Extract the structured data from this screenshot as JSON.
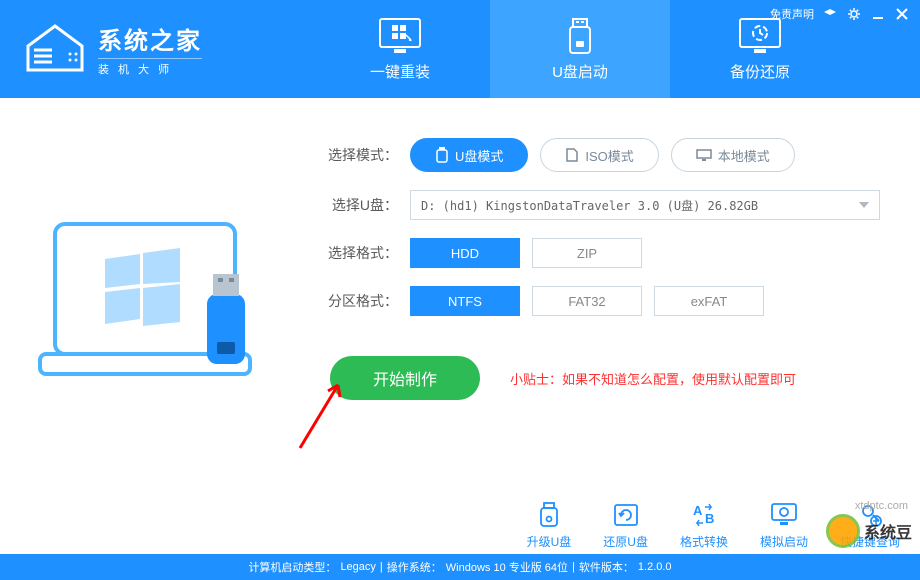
{
  "header": {
    "logo_title": "系统之家",
    "logo_sub": "装 机 大 师",
    "disclaimer": "免责声明"
  },
  "nav": {
    "tabs": [
      {
        "label": "一键重装",
        "active": false
      },
      {
        "label": "U盘启动",
        "active": true
      },
      {
        "label": "备份还原",
        "active": false
      }
    ]
  },
  "mode_select": {
    "label": "选择模式：",
    "options": [
      {
        "label": "U盘模式",
        "selected": true
      },
      {
        "label": "ISO模式",
        "selected": false
      },
      {
        "label": "本地模式",
        "selected": false
      }
    ]
  },
  "usb_select": {
    "label": "选择U盘：",
    "value": "D: (hd1) KingstonDataTraveler 3.0 (U盘) 26.82GB"
  },
  "format_select": {
    "label": "选择格式：",
    "options": [
      {
        "label": "HDD",
        "selected": true
      },
      {
        "label": "ZIP",
        "selected": false
      }
    ]
  },
  "partition_select": {
    "label": "分区格式：",
    "options": [
      {
        "label": "NTFS",
        "selected": true
      },
      {
        "label": "FAT32",
        "selected": false
      },
      {
        "label": "exFAT",
        "selected": false
      }
    ]
  },
  "start": {
    "button": "开始制作",
    "tip": "小贴士：如果不知道怎么配置，使用默认配置即可"
  },
  "tools": {
    "items": [
      {
        "label": "升级U盘"
      },
      {
        "label": "还原U盘"
      },
      {
        "label": "格式转换"
      },
      {
        "label": "模拟启动"
      },
      {
        "label": "快捷键查询"
      }
    ]
  },
  "status": {
    "boot_type_label": "计算机启动类型：",
    "boot_type": "Legacy",
    "os_label": "操作系统：",
    "os": "Windows 10 专业版 64位",
    "ver_label": "软件版本：",
    "ver": "1.2.0.0"
  },
  "watermark": {
    "site": "xtdptc.com",
    "brand": "系统豆"
  }
}
